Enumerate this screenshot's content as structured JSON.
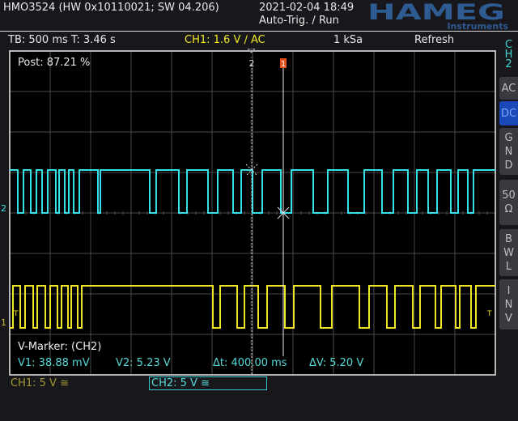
{
  "header": {
    "title": "HMO3524 (HW 0x10110021; SW 04.206)",
    "date": "2021-02-04 18:49",
    "mode": "Auto-Trig. / Run",
    "brand": "HAMEG",
    "brand_sub": "Instruments"
  },
  "info_bar": {
    "timebase": "TB: 500 ms  T: 3.46 s",
    "ch1_trigger": "CH1: 1.6 V ∕ AC",
    "sample_rate": "1 kSa",
    "acq_mode": "Refresh"
  },
  "side_menu": {
    "channel": [
      "C",
      "H",
      "2"
    ],
    "buttons": [
      {
        "label": "AC",
        "active": false
      },
      {
        "label": "DC",
        "active": true
      },
      {
        "label": "G N D",
        "active": false
      },
      {
        "label": "50 Ω",
        "active": false
      },
      {
        "label": "B W L",
        "active": false
      },
      {
        "label": "I N V",
        "active": false
      }
    ]
  },
  "screen": {
    "post": "Post: 87.21 %",
    "marker2_label": "2",
    "marker1_label": "1",
    "ch2_ground_label": "2",
    "ch1_ground_label": "1",
    "trigger_label": "T"
  },
  "v_marker": {
    "title": "V-Marker: (CH2)",
    "v1": "V1: 38.88 mV",
    "v2": "V2: 5.23 V",
    "dt": "Δt: 400.00 ms",
    "dv": "ΔV: 5.20 V"
  },
  "channels": {
    "ch1": "CH1: 5 V ≅",
    "ch2": "CH2: 5 V ≅"
  },
  "colors": {
    "ch1": "#f0e426",
    "ch2": "#35e2ea",
    "marker": "#e8501c"
  },
  "traces": {
    "time_per_div_ms": 500,
    "ch2": {
      "start_high": true,
      "edges_ms": [
        100,
        170,
        260,
        330,
        400,
        470,
        570,
        610,
        680,
        730,
        790,
        860,
        1090,
        1120,
        1730,
        1810,
        2090,
        2190,
        2450,
        2570,
        2760,
        2860,
        3000,
        3120,
        3350,
        3480,
        3750,
        3930,
        4180,
        4380,
        4600,
        4740,
        4920,
        5030,
        5170,
        5280,
        5450,
        5540,
        5660,
        5730
      ]
    },
    "ch1": {
      "start_high": false,
      "edges_ms": [
        40,
        130,
        190,
        290,
        340,
        440,
        500,
        590,
        640,
        720,
        760,
        840,
        890,
        2510,
        2600,
        2810,
        2900,
        3070,
        3180,
        3400,
        3510,
        3840,
        3980,
        4320,
        4440,
        4660,
        4760,
        4980,
        5070,
        5260,
        5330,
        5510,
        5560,
        5700,
        5760
      ]
    }
  }
}
